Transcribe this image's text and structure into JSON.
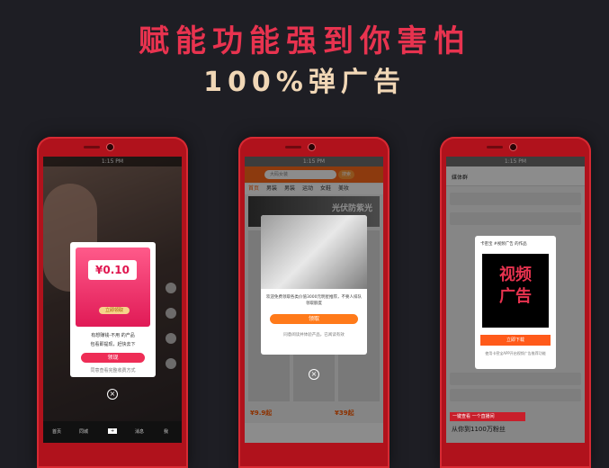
{
  "headline": {
    "line1": "赋能功能强到你害怕",
    "line2": "100%弹广告"
  },
  "colors": {
    "background": "#1e1e24",
    "headline_red": "#e8334f",
    "headline_cream": "#f1d7b6",
    "phone_body": "#b0121c"
  },
  "phone1": {
    "status_time": "1:15 PM",
    "ad": {
      "amount": "¥0.10",
      "claim_button": "立即领取",
      "line1": "有想赚钱-不用 的产品",
      "line2": "包看即提现，赶快去下",
      "go_button": "领现",
      "footer": "同意查看完整收费方式"
    },
    "tabbar": [
      "首页",
      "同城",
      "+",
      "消息",
      "我"
    ]
  },
  "phone2": {
    "status_time": "1:15 PM",
    "search_placeholder": "大码女装",
    "search_button": "搜索",
    "tabs": [
      "首页",
      "男装",
      "男装",
      "运动",
      "女鞋",
      "美妆"
    ],
    "banner_text": "光伏防紫光",
    "ad": {
      "desc": "欢迎免费领取各类价值3000元明星推荐，不要人排队领取额度",
      "ok_button": "领取",
      "small": "同意阅读并体验产品，已阅读有效"
    },
    "prices": [
      "¥9.9起",
      "¥39起"
    ]
  },
  "phone3": {
    "status_time": "1:15 PM",
    "header_text": "媒体群",
    "ad": {
      "header": "卡密宝 #视频广告 的作品",
      "video_line1": "视频",
      "video_line2": "广告",
      "install_button": "立即下载",
      "small": "使用卡密宝APP开启视频广告推荐功能"
    },
    "red_bar": "一键查看 一个直播间",
    "footer": "从你到1100万粉丝"
  }
}
